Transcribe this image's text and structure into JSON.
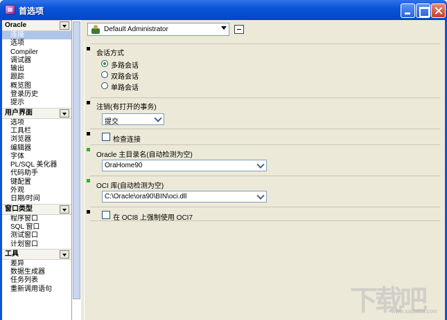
{
  "window": {
    "title": "首选项"
  },
  "nav": {
    "groups": [
      {
        "title": "Oracle",
        "items": [
          "连接",
          "选项",
          "Compiler",
          "调试器",
          "输出",
          "跟踪",
          "概览图",
          "登录历史",
          "提示"
        ]
      },
      {
        "title": "用户界面",
        "items": [
          "选项",
          "工具栏",
          "浏览器",
          "编辑器",
          "字体",
          "PL/SQL 美化器",
          "代码助手",
          "键配置",
          "外观",
          "日期/时间"
        ]
      },
      {
        "title": "窗口类型",
        "items": [
          "程序窗口",
          "SQL 窗口",
          "测试窗口",
          "计划窗口"
        ]
      },
      {
        "title": "工具",
        "items": [
          "差异",
          "数据生成器",
          "任务列表",
          "重新调用语句"
        ]
      }
    ],
    "selected_item": "连接"
  },
  "profile": {
    "value": "Default Administrator"
  },
  "sections": {
    "session_mode": {
      "title": "会话方式",
      "options": [
        "多路会话",
        "双路会话",
        "单路会话"
      ],
      "selected": "多路会话"
    },
    "logoff": {
      "title": "注销(有打开的事务)",
      "value": "提交"
    },
    "check_connection": {
      "label": "检查连接",
      "checked": false
    },
    "oracle_home": {
      "title": "Oracle 主目录名(自动检测为空)",
      "value": "OraHome90"
    },
    "oci_library": {
      "title": "OCI 库(自动检测为空)",
      "value": "C:\\Oracle\\ora90\\BIN\\oci.dll"
    },
    "force_oci7": {
      "label": "在 OCI8 上强制使用 OCI7",
      "checked": false
    }
  },
  "watermark": {
    "logo": "下载吧",
    "url": "www.xiazaiba.com"
  },
  "colors": {
    "titlebar": "#0a55d8",
    "panel": "#ece9d8",
    "nav_selected": "#b0c4e8",
    "marker_green": "#28b428"
  }
}
